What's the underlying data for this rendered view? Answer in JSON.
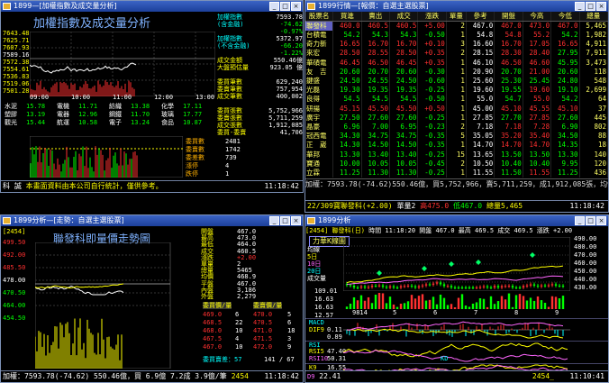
{
  "w1": {
    "title": "1899—[加權指數及成交量分析]",
    "chart_title": "加權指數及成交量分析",
    "yaxis": [
      "7643.48",
      "7625.71",
      "7607.93",
      "7589.16",
      "7572.38",
      "7554.61",
      "7536.83",
      "7519.06",
      "7501.28"
    ],
    "time": [
      "09:00",
      "10:00",
      "11:00",
      "12:00",
      "13:00"
    ],
    "info": [
      [
        "加權指數",
        "7593.78"
      ],
      [
        "(含金融)",
        "-74.62"
      ],
      [
        "",
        "-0.97%"
      ],
      [
        "加權指數",
        "5372.97"
      ],
      [
        "(不含金融)",
        "-66.20"
      ],
      [
        "",
        "-1.22%"
      ],
      [
        "成交金額",
        "550.46億"
      ],
      [
        "大盤預估量",
        "923.05 億"
      ],
      [
        "",
        ""
      ],
      [
        "委買筆數",
        "629,240"
      ],
      [
        "委賣筆數",
        "757,954"
      ],
      [
        "成交筆數",
        "400,002"
      ],
      [
        "",
        ""
      ],
      [
        "委買張數",
        "5,752,966"
      ],
      [
        "委賣張數",
        "5,711,259"
      ],
      [
        "成交張數",
        "1,912,085"
      ],
      [
        "委買-委賣",
        "41,706"
      ]
    ],
    "sec": [
      [
        "水泥",
        "15.78"
      ],
      [
        "電機",
        "11.71"
      ],
      [
        "紡織",
        "13.38"
      ],
      [
        "化學",
        "17.11"
      ],
      [
        "塑膠",
        "13.19"
      ],
      [
        "電器",
        "12.96"
      ],
      [
        "鋼鐵",
        "11.70"
      ],
      [
        "玻璃",
        "17.77"
      ],
      [
        "觀光",
        "15.44"
      ],
      [
        "航運",
        "10.58"
      ],
      [
        "電子",
        "13.24"
      ],
      [
        "食品",
        "10.87"
      ]
    ],
    "sec2": [
      [
        "委買數",
        "2481"
      ],
      [
        "委賣數",
        "1742"
      ],
      [
        "委差數",
        "739"
      ],
      [
        "漲停",
        "4"
      ],
      [
        "跌停",
        "1"
      ]
    ],
    "status": "本畫面資料由本公司自行統計，僅供參考。",
    "clock": "11:18:42"
  },
  "w2": {
    "title": "1899行情—[報價：自選主選股票]",
    "headers": [
      "股票名",
      "買進",
      "賣出",
      "成交",
      "漲跌",
      "單量",
      "參考",
      "開盤",
      "今高",
      "今低",
      "總量"
    ],
    "rows": [
      [
        "聯發科",
        "460.0",
        "460.5",
        "460.5",
        "+5.00",
        "2",
        "467.0",
        "467.0",
        "473.0",
        "467.0",
        "5,465"
      ],
      [
        "台積電",
        "54.2",
        "54.3",
        "54.3",
        "-0.50",
        "1",
        "54.8",
        "54.8",
        "55.2",
        "54.2",
        "1,982"
      ],
      [
        "奇力新",
        "16.65",
        "16.70",
        "16.70",
        "+0.10",
        "3",
        "16.60",
        "16.70",
        "17.05",
        "16.65",
        "4,911"
      ],
      [
        "來宏",
        "28.50",
        "28.55",
        "28.50",
        "+0.35",
        "2",
        "28.15",
        "28.30",
        "28.40",
        "27.95",
        "7,911"
      ],
      [
        "華碩電",
        "46.45",
        "46.50",
        "46.45",
        "+0.35",
        "1",
        "46.10",
        "46.50",
        "46.60",
        "45.95",
        "3,473"
      ],
      [
        "友　吉",
        "20.60",
        "20.70",
        "20.60",
        "-0.30",
        "1",
        "20.90",
        "20.70",
        "21.00",
        "20.60",
        "118"
      ],
      [
        "鍵盛",
        "24.50",
        "24.55",
        "24.50",
        "-0.60",
        "1",
        "25.60",
        "25.30",
        "25.45",
        "24.80",
        "548"
      ],
      [
        "光磊",
        "19.30",
        "19.35",
        "19.35",
        "-0.25",
        "1",
        "19.60",
        "19.55",
        "19.60",
        "19.10",
        "2,699"
      ],
      [
        "良得",
        "54.5",
        "54.5",
        "54.5",
        "-0.50",
        "1",
        "55.0",
        "54.7",
        "55.0",
        "54.2",
        "64"
      ],
      [
        "研揚",
        "45.15",
        "45.50",
        "45.50",
        "+0.50",
        "1",
        "45.00",
        "45.10",
        "45.55",
        "45.10",
        "37"
      ],
      [
        "廣宇",
        "27.50",
        "27.60",
        "27.60",
        "-0.25",
        "1",
        "27.85",
        "27.70",
        "27.85",
        "27.60",
        "445"
      ],
      [
        "晶豪",
        "6.96",
        "7.00",
        "6.95",
        "-0.23",
        "2",
        "7.18",
        "7.18",
        "7.28",
        "6.90",
        "802"
      ],
      [
        "冠西電",
        "34.30",
        "34.75",
        "34.75",
        "-0.35",
        "5",
        "35.05",
        "35.20",
        "35.40",
        "34.50",
        "88"
      ],
      [
        "正　崴",
        "14.30",
        "14.50",
        "14.50",
        "-0.35",
        "1",
        "14.70",
        "14.70",
        "14.70",
        "14.35",
        "18"
      ],
      [
        "華邦",
        "13.30",
        "13.40",
        "13.40",
        "-0.25",
        "15",
        "13.65",
        "13.50",
        "13.50",
        "13.30",
        "140"
      ],
      [
        "寶通",
        "10.00",
        "10.05",
        "10.05",
        "-0.45",
        "2",
        "10.50",
        "10.40",
        "10.40",
        "9.95",
        "120"
      ],
      [
        "立霖",
        "11.25",
        "11.30",
        "11.30",
        "-0.25",
        "1",
        "11.55",
        "11.50",
        "11.55",
        "11.25",
        "436"
      ]
    ],
    "status1": "加權：7593.78(-74.62)550.46億，買5,752,966，賣5,711,259，成1,912,085張，均953.9",
    "status2a": "22/309寶聯發科(+2.00)",
    "status2b": "單量2",
    "status2c": "高475.0",
    "status2d": "低467.0",
    "status2e": "總量5,465",
    "clock": "11:18:42"
  },
  "w3": {
    "title": "1899分析—[走勢：自選主選股票]",
    "code": "[2454]",
    "chart_title": "聯發科即量價走勢圖",
    "yaxis": [
      "499.50",
      "492.00",
      "485.50",
      "478.00",
      "470.50",
      "464.00",
      "454.50"
    ],
    "time": [
      "09:00",
      "10:00",
      "11:00",
      "12:00",
      "13:00"
    ],
    "info": [
      [
        "開盤",
        "467.0"
      ],
      [
        "最高",
        "473.0"
      ],
      [
        "最低",
        "464.0"
      ],
      [
        "成交",
        "460.5"
      ],
      [
        "漲跌",
        "+2.00"
      ],
      [
        "單量",
        "2"
      ],
      [
        "總量",
        "5465"
      ],
      [
        "均價",
        "468.9"
      ],
      [
        "平盤",
        "467.0"
      ],
      [
        "內盤",
        "3,186"
      ],
      [
        "外盤",
        "2,279"
      ]
    ],
    "bid_hdr": [
      "委買價/量",
      "委賣價/量"
    ],
    "bids": [
      [
        "469.0",
        "6"
      ],
      [
        "468.5",
        "22"
      ],
      [
        "468.0",
        "10"
      ],
      [
        "467.5",
        "4"
      ],
      [
        "467.0",
        "10"
      ]
    ],
    "asks": [
      [
        "470.0",
        "5"
      ],
      [
        "470.5",
        "6"
      ],
      [
        "471.0",
        "18"
      ],
      [
        "471.5",
        "3"
      ],
      [
        "472.0",
        "9"
      ]
    ],
    "bid_total": "委買賣差：57",
    "bid_total2": "141 / 67",
    "status": "加權：7593.78(-74.62) 550.46億，買 6.9億 7.2成 3.9億/筆",
    "code2": "2454",
    "clock": "11:18:42"
  },
  "w4": {
    "title": "1899分析",
    "code": "[2454] 聯發科(日)",
    "tab": "力華K線圖",
    "infobar": "時間 11:18:20 開盤 467.0 最高 469.5 成交 469.5 漲跌 +2.00",
    "side": [
      [
        "均線",
        "18"
      ],
      [
        "5日",
        "469.9"
      ],
      [
        "10日",
        "467.6"
      ],
      [
        "20日",
        "462.9"
      ],
      [
        "成交量",
        "12.0"
      ]
    ],
    "vals": [
      "109.01",
      "16.63",
      "16.63",
      "12.57"
    ],
    "yaxis": [
      "490.00",
      "480.00",
      "470.00",
      "460.00",
      "450.00",
      "440.00",
      "430.00"
    ],
    "macd": {
      "label": "MACD",
      "v1": "0.11",
      "v2": "0.89",
      "dif": "DIF9"
    },
    "rsi": {
      "label": "RSI",
      "v1": "47.40",
      "v2": "50.31",
      "l1": "RSI5",
      "l2": "RSI10"
    },
    "kd": {
      "label": "KD",
      "v1": "16.55",
      "v2": "22.41",
      "l1": "K9",
      "l2": "D9"
    },
    "xlab": [
      "9814",
      "5",
      "6",
      "7",
      "8",
      "9"
    ],
    "status": "2454_",
    "clock": "11:10:41"
  }
}
